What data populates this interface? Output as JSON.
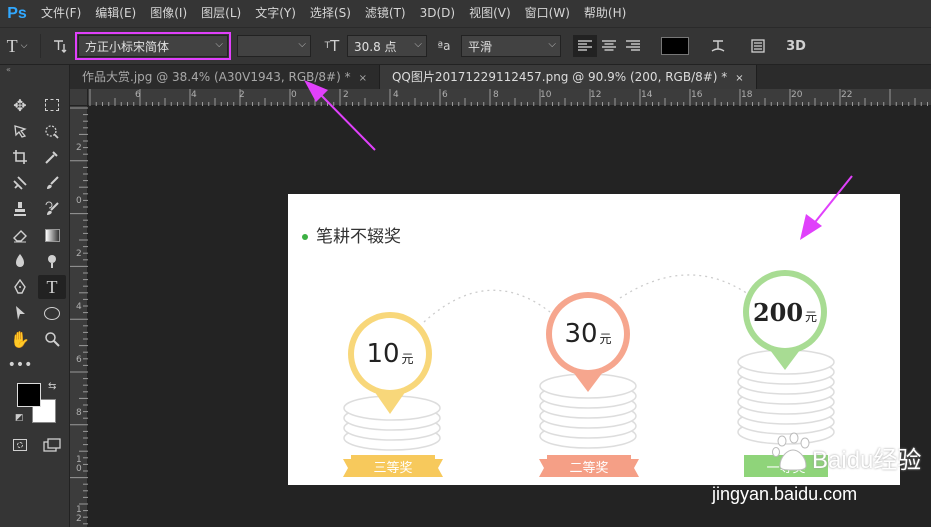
{
  "app": {
    "logo": "Ps"
  },
  "menu": [
    "文件(F)",
    "编辑(E)",
    "图像(I)",
    "图层(L)",
    "文字(Y)",
    "选择(S)",
    "滤镜(T)",
    "3D(D)",
    "视图(V)",
    "窗口(W)",
    "帮助(H)"
  ],
  "options": {
    "tool_glyph": "T",
    "font_family": "方正小标宋简体",
    "font_size": "30.8 点",
    "aa_label": "ªa",
    "antialias": "平滑",
    "three_d": "3D"
  },
  "tabs": [
    {
      "label": "作品大赏.jpg @ 38.4% (A30V1943, RGB/8#) *",
      "close": "×"
    },
    {
      "label": "QQ图片20171229112457.png @ 90.9% (200, RGB/8#) *",
      "close": "×"
    }
  ],
  "rulers": {
    "top": [
      "6",
      "4",
      "2",
      "0",
      "2",
      "4",
      "6",
      "8",
      "10",
      "12",
      "14",
      "16",
      "18",
      "20",
      "22"
    ],
    "left": [
      "2",
      "0",
      "2",
      "4",
      "6",
      "8",
      "1 0",
      "1 2"
    ]
  },
  "document": {
    "title": "笔耕不辍奖",
    "prizes": [
      {
        "amount": "10",
        "unit": "元",
        "label": "三等奖",
        "color": "#f8d77a",
        "ribbon": "#f7c95c"
      },
      {
        "amount": "30",
        "unit": "元",
        "label": "二等奖",
        "color": "#f6a68e",
        "ribbon": "#f59f86"
      },
      {
        "amount": "200",
        "unit": "元",
        "label": "一等奖",
        "color": "#a8dc93",
        "ribbon": "#8fd47a"
      }
    ]
  },
  "watermark": {
    "brand": "Baidu经验",
    "url": "jingyan.baidu.com"
  },
  "colors": {
    "accent": "#e040fb",
    "ps_blue": "#31a8ff"
  }
}
